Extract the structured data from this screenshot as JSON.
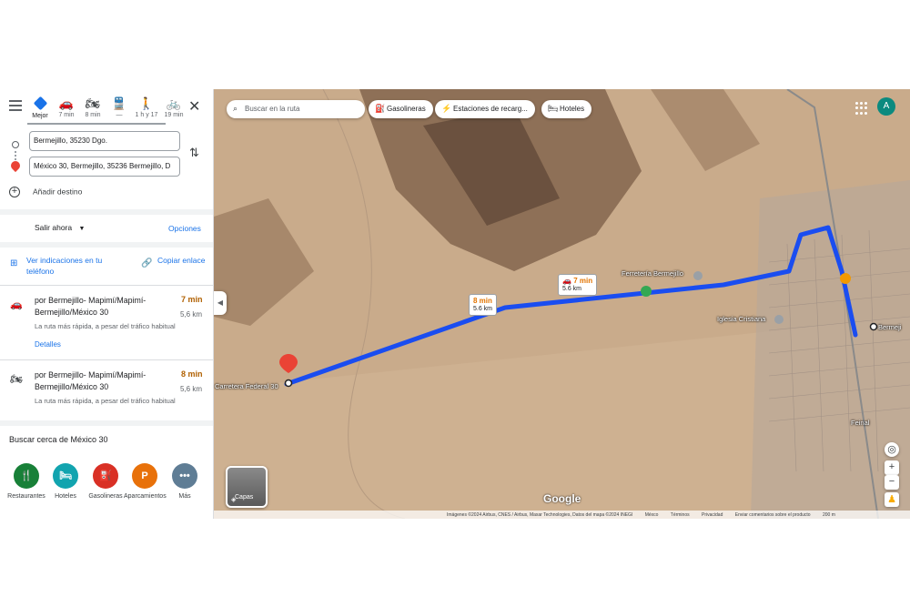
{
  "modes": [
    {
      "icon": "directions-diamond-icon",
      "label": "Mejor"
    },
    {
      "icon": "car-icon",
      "label": "7 min"
    },
    {
      "icon": "motorcycle-icon",
      "label": "8 min"
    },
    {
      "icon": "transit-icon",
      "label": "—"
    },
    {
      "icon": "walking-icon",
      "label": "1 h y 17"
    },
    {
      "icon": "bicycle-icon",
      "label": "19 min"
    }
  ],
  "origin": "Bermejillo, 35230 Dgo.",
  "destination": "México 30, Bermejillo, 35236 Bermejillo, D",
  "add_destination": "Añadir destino",
  "leave_now": "Salir ahora",
  "options": "Opciones",
  "send_to_phone": "Ver indicaciones en tu teléfono",
  "copy_link": "Copiar enlace",
  "routes": [
    {
      "name": "por Bermejillo- Mapimí/Mapimí-Bermejillo/México 30",
      "time": "7 min",
      "distance": "5,6 km",
      "note": "La ruta más rápida, a pesar del tráfico habitual",
      "details": "Detalles"
    },
    {
      "name": "por Bermejillo- Mapimí/Mapimí-Bermejillo/México 30",
      "time": "8 min",
      "distance": "5,6 km",
      "note": "La ruta más rápida, a pesar del tráfico habitual"
    }
  ],
  "nearby_title": "Buscar cerca de México 30",
  "nearby": [
    {
      "label": "Restaurantes",
      "color": "#188038",
      "glyph": "🍴"
    },
    {
      "label": "Hoteles",
      "color": "#12a4af",
      "glyph": "🛏"
    },
    {
      "label": "Gasolineras",
      "color": "#d93025",
      "glyph": "⛽"
    },
    {
      "label": "Aparcamientos",
      "color": "#e8710a",
      "glyph": "P"
    },
    {
      "label": "Más",
      "color": "#5f7d95",
      "glyph": "•••"
    }
  ],
  "map": {
    "search_placeholder": "Buscar en la ruta",
    "chips": [
      "Gasolineras",
      "Estaciones de recarg...",
      "Hoteles"
    ],
    "avatar": "A",
    "callout_primary": {
      "time": "7 min",
      "dist": "5.6 km"
    },
    "callout_alt": {
      "time": "8 min",
      "dist": "5.6 km"
    },
    "labels": {
      "start": "Carretera Federal 30",
      "end": "Bermeji",
      "poi1": "Ferretería Bermejillo",
      "poi2": "Iglesia Cristiana",
      "poi3": "Feinal"
    },
    "layers": "Capas",
    "google": "Google",
    "footer": [
      "Imágenes ©2024 Airbus, CNES / Airbus, Maxar Technologies, Datos del mapa ©2024 INEGI",
      "Méxco",
      "Términos",
      "Privacidad",
      "Enviar comentarios sobre el producto",
      "200 m"
    ]
  },
  "colors": {
    "route": "#1a4df0",
    "accent": "#1a73e8",
    "time": "#b06000"
  }
}
